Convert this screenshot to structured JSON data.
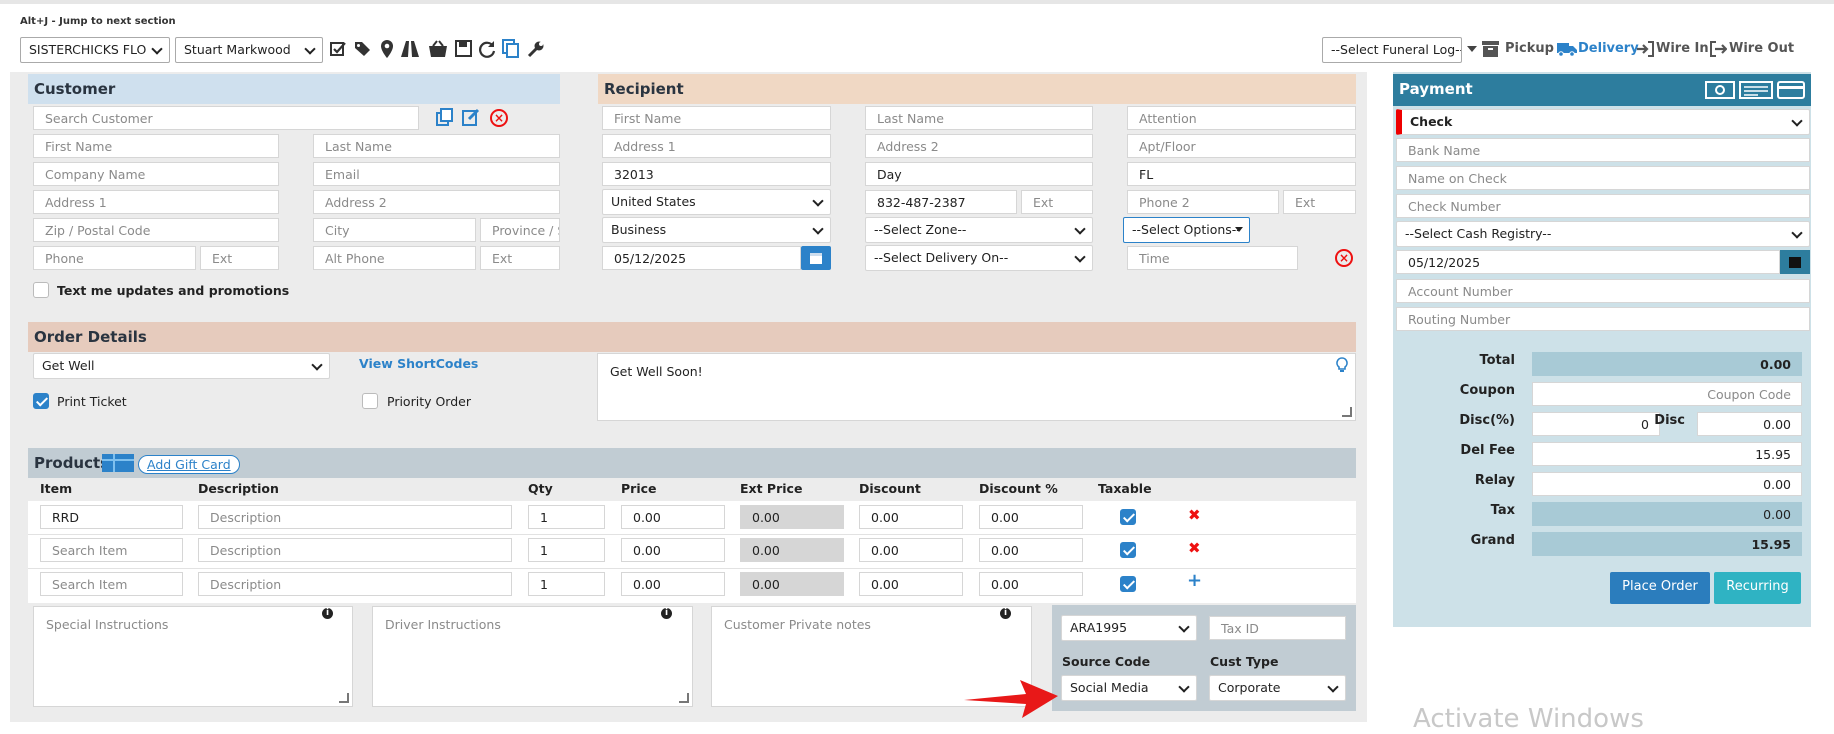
{
  "topbar": {
    "shortcut": "Alt+J - Jump to next section",
    "store_select": "SISTERCHICKS FLO",
    "user_select": "Stuart Markwood",
    "funeral_select": "--Select Funeral Log--",
    "pickup": "Pickup",
    "delivery": "Delivery",
    "wire_in": "Wire In",
    "wire_out": "Wire Out"
  },
  "customer": {
    "title": "Customer",
    "search": "Search Customer",
    "first_name": "First Name",
    "last_name": "Last Name",
    "company": "Company Name",
    "email": "Email",
    "address1": "Address 1",
    "address2": "Address 2",
    "zip": "Zip / Postal Code",
    "city": "City",
    "province": "Province / State",
    "phone": "Phone",
    "ext": "Ext",
    "alt_phone": "Alt Phone",
    "ext2": "Ext",
    "text_me": "Text me updates and promotions"
  },
  "recipient": {
    "title": "Recipient",
    "first_name": "First Name",
    "last_name": "Last Name",
    "attention": "Attention",
    "address1": "Address 1",
    "address2": "Address 2",
    "apt": "Apt/Floor",
    "zip": "32013",
    "city": "Day",
    "state": "FL",
    "country": "United States",
    "phone": "832-487-2387",
    "ext": "Ext",
    "phone2": "Phone 2",
    "ext2": "Ext",
    "location_type": "Business",
    "zone": "--Select Zone--",
    "options": "--Select Options--",
    "date": "05/12/2025",
    "delivery_on": "--Select Delivery On--",
    "time": "Time"
  },
  "order": {
    "title": "Order Details",
    "occasion": "Get Well",
    "shortcodes": "View ShortCodes",
    "message": "Get Well Soon!",
    "print_ticket": "Print Ticket",
    "priority": "Priority Order"
  },
  "products": {
    "title": "Products",
    "add_gift": "Add Gift Card",
    "headers": [
      "Item",
      "Description",
      "Qty",
      "Price",
      "Ext Price",
      "Discount",
      "Discount %",
      "Taxable"
    ],
    "rows": [
      {
        "item": "RRD",
        "desc": "Description",
        "qty": "1",
        "price": "0.00",
        "ext": "0.00",
        "disc": "0.00",
        "discp": "0.00"
      },
      {
        "item": "Search Item",
        "desc": "Description",
        "qty": "1",
        "price": "0.00",
        "ext": "0.00",
        "disc": "0.00",
        "discp": "0.00"
      },
      {
        "item": "Search Item",
        "desc": "Description",
        "qty": "1",
        "price": "0.00",
        "ext": "0.00",
        "disc": "0.00",
        "discp": "0.00"
      }
    ],
    "special": "Special Instructions",
    "driver": "Driver Instructions",
    "private": "Customer Private notes",
    "account": "ARA1995",
    "tax_id": "Tax ID",
    "source_label": "Source Code",
    "cust_type_label": "Cust Type",
    "source": "Social Media",
    "cust_type": "Corporate"
  },
  "payment": {
    "title": "Payment",
    "method": "Check",
    "bank": "Bank Name",
    "name_on_check": "Name on Check",
    "check_number": "Check Number",
    "registry": "--Select Cash Registry--",
    "date": "05/12/2025",
    "account": "Account Number",
    "routing": "Routing Number",
    "total_label": "Total",
    "total": "0.00",
    "coupon_label": "Coupon",
    "coupon": "Coupon Code",
    "discp_label": "Disc(%)",
    "discp": "0",
    "disc_label": "Disc",
    "disc": "0.00",
    "delfee_label": "Del Fee",
    "delfee": "15.95",
    "relay_label": "Relay",
    "relay": "0.00",
    "tax_label": "Tax",
    "tax": "0.00",
    "grand_label": "Grand",
    "grand": "15.95",
    "place_order": "Place Order",
    "recurring": "Recurring"
  },
  "watermark": "Activate Windows",
  "colors": {
    "customer_hdr": "#cfe0ee",
    "recipient_hdr": "#f0d8c4",
    "order_hdr": "#e6cbbd",
    "products_hdr": "#c1ccd3",
    "payment_hdr": "#2d7d9e",
    "payment_bg": "#cde1e8",
    "accent": "#2c82c9"
  }
}
